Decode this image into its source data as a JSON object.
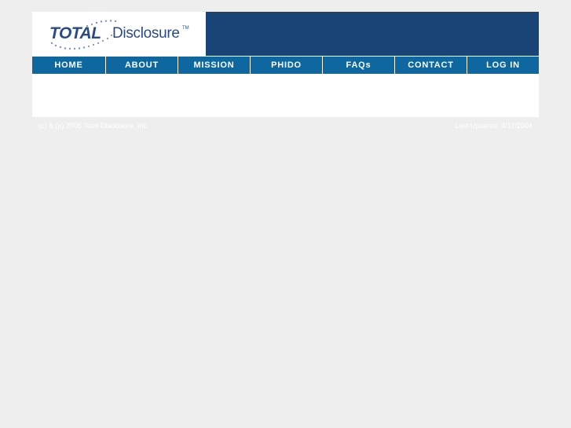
{
  "brand": {
    "logo_total": "TOTAL",
    "logo_disclosure": "Disclosure",
    "logo_tm": "TM"
  },
  "nav": {
    "items": [
      {
        "label": "HOME",
        "name": "nav-home"
      },
      {
        "label": "ABOUT",
        "name": "nav-about"
      },
      {
        "label": "MISSION",
        "name": "nav-mission"
      },
      {
        "label": "PHIDO",
        "name": "nav-phido"
      },
      {
        "label": "FAQs",
        "name": "nav-faqs"
      },
      {
        "label": "CONTACT",
        "name": "nav-contact"
      },
      {
        "label": "LOG IN",
        "name": "nav-log-in"
      }
    ]
  },
  "footer": {
    "copyright": "(c) & (p) 2005 Total Disclosure, Inc.",
    "updated": "Last Updated: 4/17/2004"
  },
  "colors": {
    "banner": "#184576",
    "nav": "#0f67a0",
    "logo_text": "#2b4a86",
    "page_bg": "#eeeeee"
  }
}
